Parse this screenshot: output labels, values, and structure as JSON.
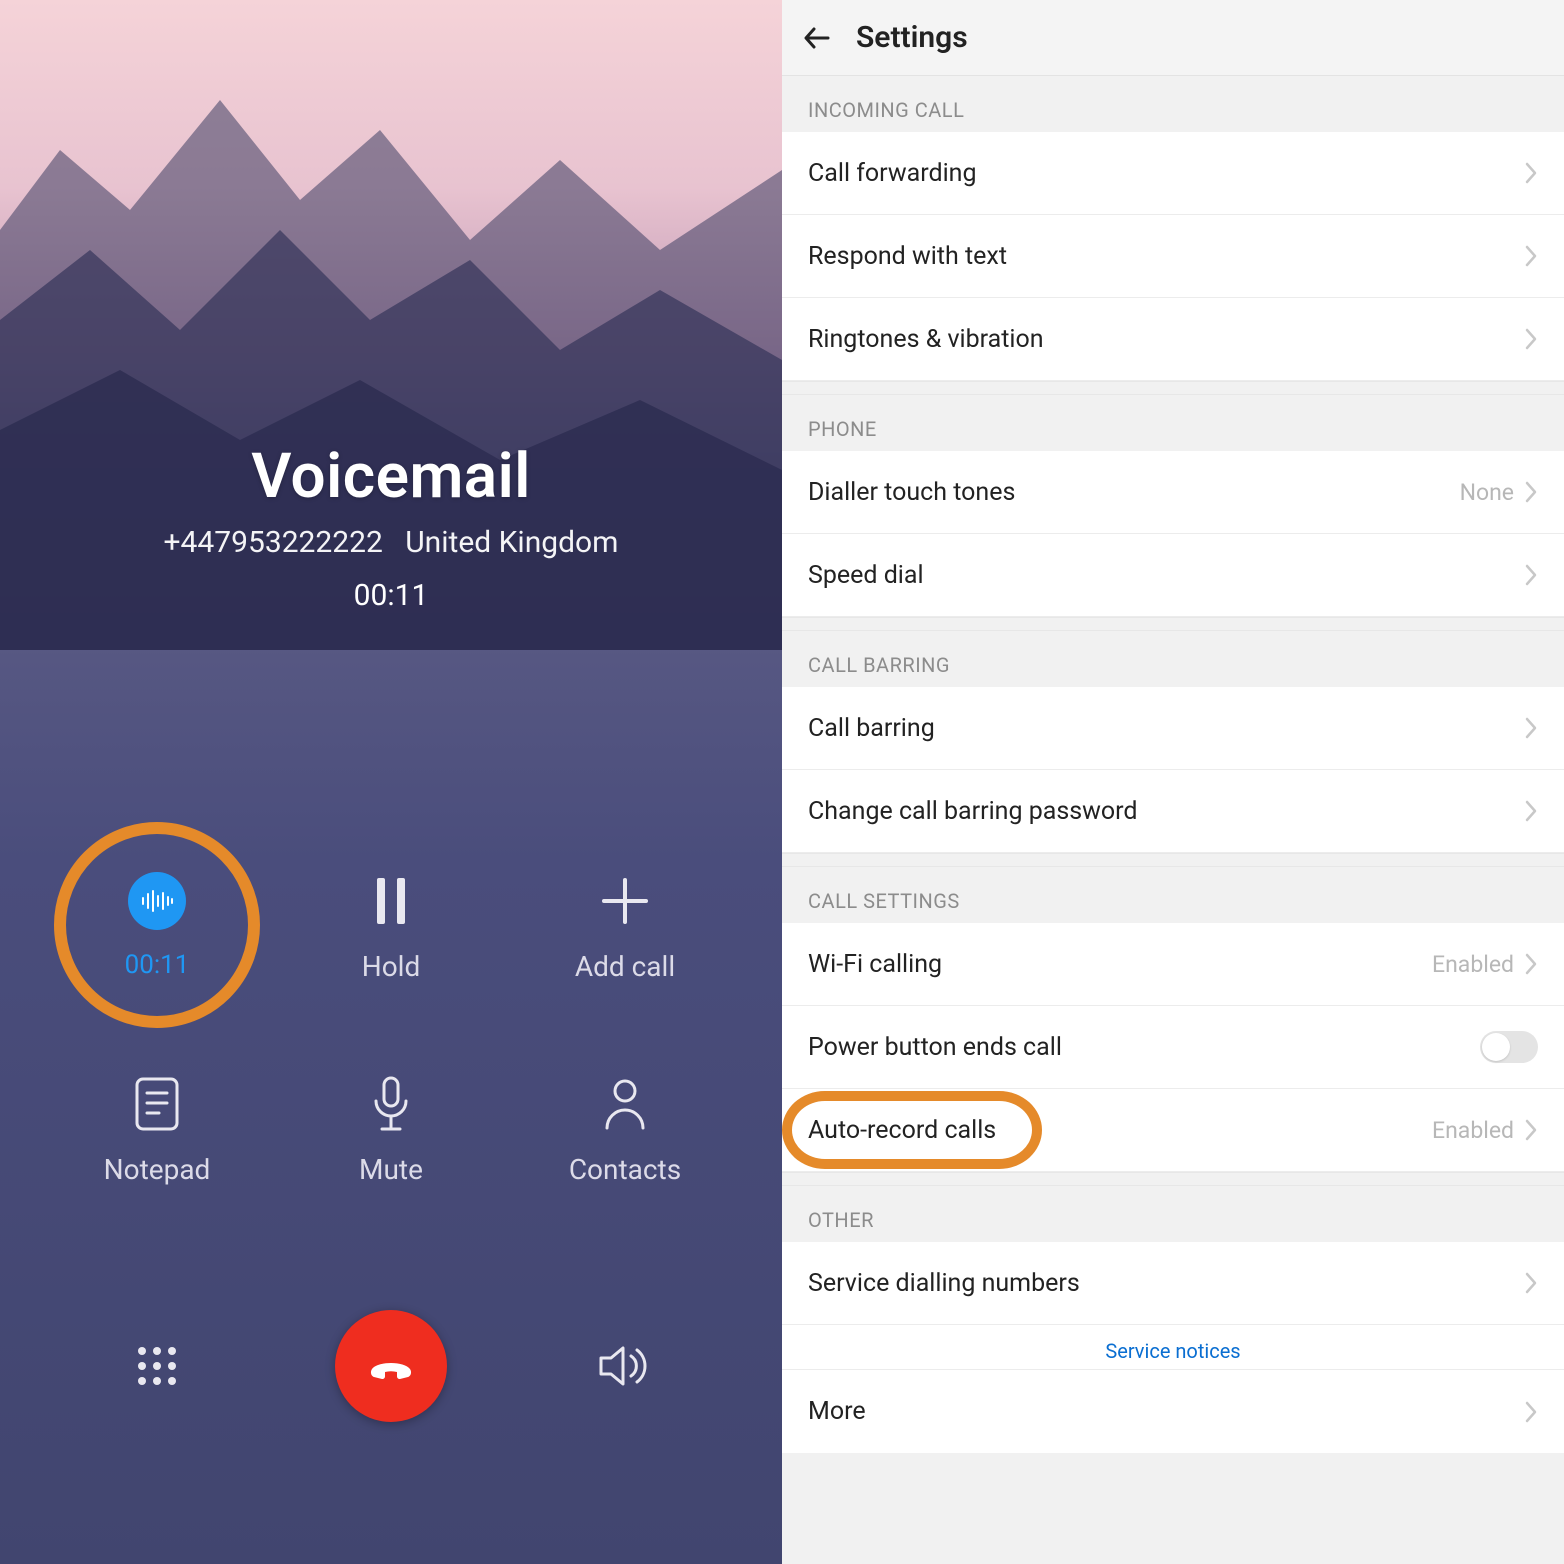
{
  "call": {
    "title": "Voicemail",
    "number": "+447953222222",
    "region": "United Kingdom",
    "duration": "00:11",
    "record_timer": "00:11",
    "buttons": {
      "hold": "Hold",
      "add_call": "Add call",
      "notepad": "Notepad",
      "mute": "Mute",
      "contacts": "Contacts"
    }
  },
  "settings": {
    "title": "Settings",
    "sections": {
      "incoming_call": {
        "header": "INCOMING CALL",
        "call_forwarding": "Call forwarding",
        "respond_with_text": "Respond with text",
        "ringtones_vibration": "Ringtones & vibration"
      },
      "phone": {
        "header": "PHONE",
        "dialler_touch_tones": "Dialler touch tones",
        "dialler_touch_tones_value": "None",
        "speed_dial": "Speed dial"
      },
      "call_barring": {
        "header": "CALL BARRING",
        "call_barring": "Call barring",
        "change_password": "Change call barring password"
      },
      "call_settings": {
        "header": "CALL SETTINGS",
        "wifi_calling": "Wi-Fi calling",
        "wifi_calling_value": "Enabled",
        "power_button_ends": "Power button ends call",
        "auto_record": "Auto-record calls",
        "auto_record_value": "Enabled"
      },
      "other": {
        "header": "OTHER",
        "service_dialling": "Service dialling numbers",
        "service_notices": "Service notices",
        "more": "More"
      }
    }
  }
}
